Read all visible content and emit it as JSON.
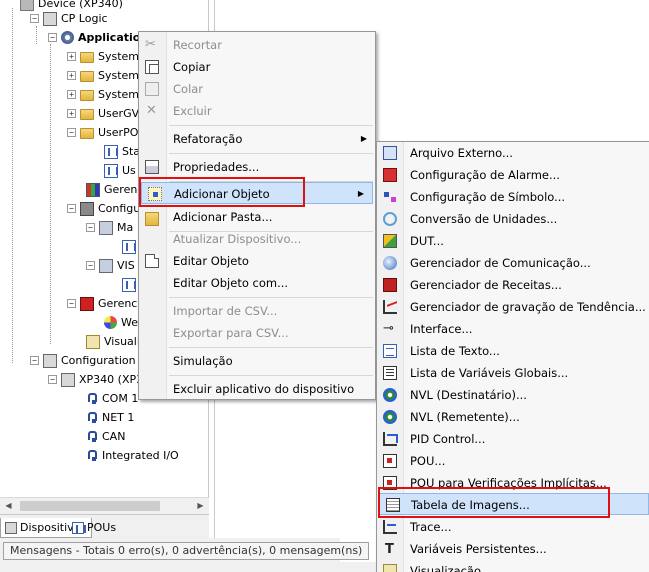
{
  "tree": {
    "top_partial": "Device (XP340)",
    "items": [
      {
        "label": "CP Logic"
      },
      {
        "label": "Applicatio"
      },
      {
        "label": "System"
      },
      {
        "label": "System"
      },
      {
        "label": "System"
      },
      {
        "label": "UserGV"
      },
      {
        "label": "UserPO"
      },
      {
        "label": "Sta"
      },
      {
        "label": "Us"
      },
      {
        "label": "Gerenc"
      },
      {
        "label": "Configu"
      },
      {
        "label": "Ma"
      },
      {
        "label": "VIS"
      },
      {
        "label": "Gerenc"
      },
      {
        "label": "We"
      },
      {
        "label": "Visualiz"
      },
      {
        "label": "Configuration ("
      },
      {
        "label": "XP340 (XP3"
      },
      {
        "label": "COM 1"
      },
      {
        "label": "NET 1"
      },
      {
        "label": "CAN"
      },
      {
        "label": "Integrated I/O"
      }
    ]
  },
  "tabs": [
    {
      "label": "Dispositivos"
    },
    {
      "label": "POUs"
    }
  ],
  "messages": {
    "label": "Mensagens - Totais 0 erro(s), 0 advertência(s), 0 mensagem(ns)"
  },
  "context_menu": {
    "items": [
      {
        "label": "Recortar",
        "enabled": false,
        "icon": "scissors-icon"
      },
      {
        "label": "Copiar",
        "enabled": true,
        "icon": "copy-icon"
      },
      {
        "label": "Colar",
        "enabled": false,
        "icon": "paste-icon"
      },
      {
        "label": "Excluir",
        "enabled": false,
        "icon": "delete-icon"
      },
      {
        "label": "Refatoração",
        "enabled": true,
        "submenu": true
      },
      {
        "label": "Propriedades...",
        "enabled": true,
        "icon": "properties-icon"
      },
      {
        "label": "Adicionar Objeto",
        "enabled": true,
        "submenu": true,
        "highlighted": true,
        "icon": "add-object-icon"
      },
      {
        "label": "Adicionar Pasta...",
        "enabled": true,
        "icon": "folder-icon"
      },
      {
        "label": "Atualizar Dispositivo...",
        "enabled": false
      },
      {
        "label": "Editar Objeto",
        "enabled": true,
        "icon": "edit-object-icon"
      },
      {
        "label": "Editar Objeto com...",
        "enabled": true
      },
      {
        "label": "Importar de CSV...",
        "enabled": false
      },
      {
        "label": "Exportar para CSV...",
        "enabled": false
      },
      {
        "label": "Simulação",
        "enabled": true
      },
      {
        "label": "Excluir aplicativo do dispositivo",
        "enabled": true
      }
    ]
  },
  "submenu": {
    "items": [
      {
        "label": "Arquivo Externo..."
      },
      {
        "label": "Configuração de Alarme..."
      },
      {
        "label": "Configuração de Símbolo..."
      },
      {
        "label": "Conversão de Unidades..."
      },
      {
        "label": "DUT..."
      },
      {
        "label": "Gerenciador de Comunicação..."
      },
      {
        "label": "Gerenciador de Receitas..."
      },
      {
        "label": "Gerenciador de gravação de Tendência..."
      },
      {
        "label": "Interface..."
      },
      {
        "label": "Lista de Texto..."
      },
      {
        "label": "Lista de Variáveis Globais..."
      },
      {
        "label": "NVL (Destinatário)..."
      },
      {
        "label": "NVL (Remetente)..."
      },
      {
        "label": "PID Control..."
      },
      {
        "label": "POU..."
      },
      {
        "label": "POU para Verificações Implícitas..."
      },
      {
        "label": "Tabela de Imagens...",
        "highlighted": true
      },
      {
        "label": "Trace..."
      },
      {
        "label": "Variáveis Persistentes..."
      },
      {
        "label": "Visualização..."
      }
    ]
  },
  "colors": {
    "highlight_border": "#e01010",
    "selection_bg": "#cfe3fb"
  }
}
